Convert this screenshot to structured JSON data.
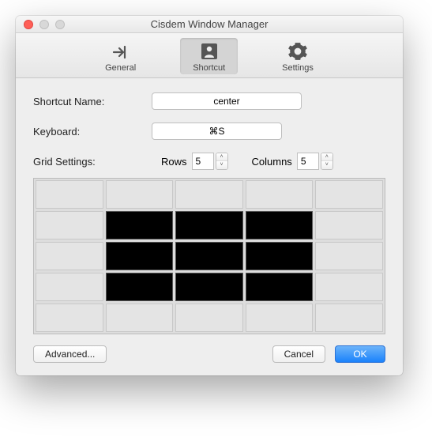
{
  "window": {
    "title": "Cisdem Window Manager"
  },
  "toolbar": {
    "items": [
      {
        "label": "General",
        "icon": "general-icon"
      },
      {
        "label": "Shortcut",
        "icon": "shortcut-icon"
      },
      {
        "label": "Settings",
        "icon": "settings-icon"
      }
    ],
    "active_index": 1
  },
  "form": {
    "shortcut_name_label": "Shortcut Name:",
    "shortcut_name_value": "center",
    "keyboard_label": "Keyboard:",
    "keyboard_value": "⌘S",
    "grid_settings_label": "Grid Settings:",
    "rows_label": "Rows",
    "rows_value": "5",
    "columns_label": "Columns",
    "columns_value": "5"
  },
  "grid": {
    "rows": 5,
    "columns": 5,
    "selected": [
      [
        1,
        1
      ],
      [
        1,
        2
      ],
      [
        1,
        3
      ],
      [
        2,
        1
      ],
      [
        2,
        2
      ],
      [
        2,
        3
      ],
      [
        3,
        1
      ],
      [
        3,
        2
      ],
      [
        3,
        3
      ]
    ]
  },
  "buttons": {
    "advanced": "Advanced...",
    "cancel": "Cancel",
    "ok": "OK"
  }
}
